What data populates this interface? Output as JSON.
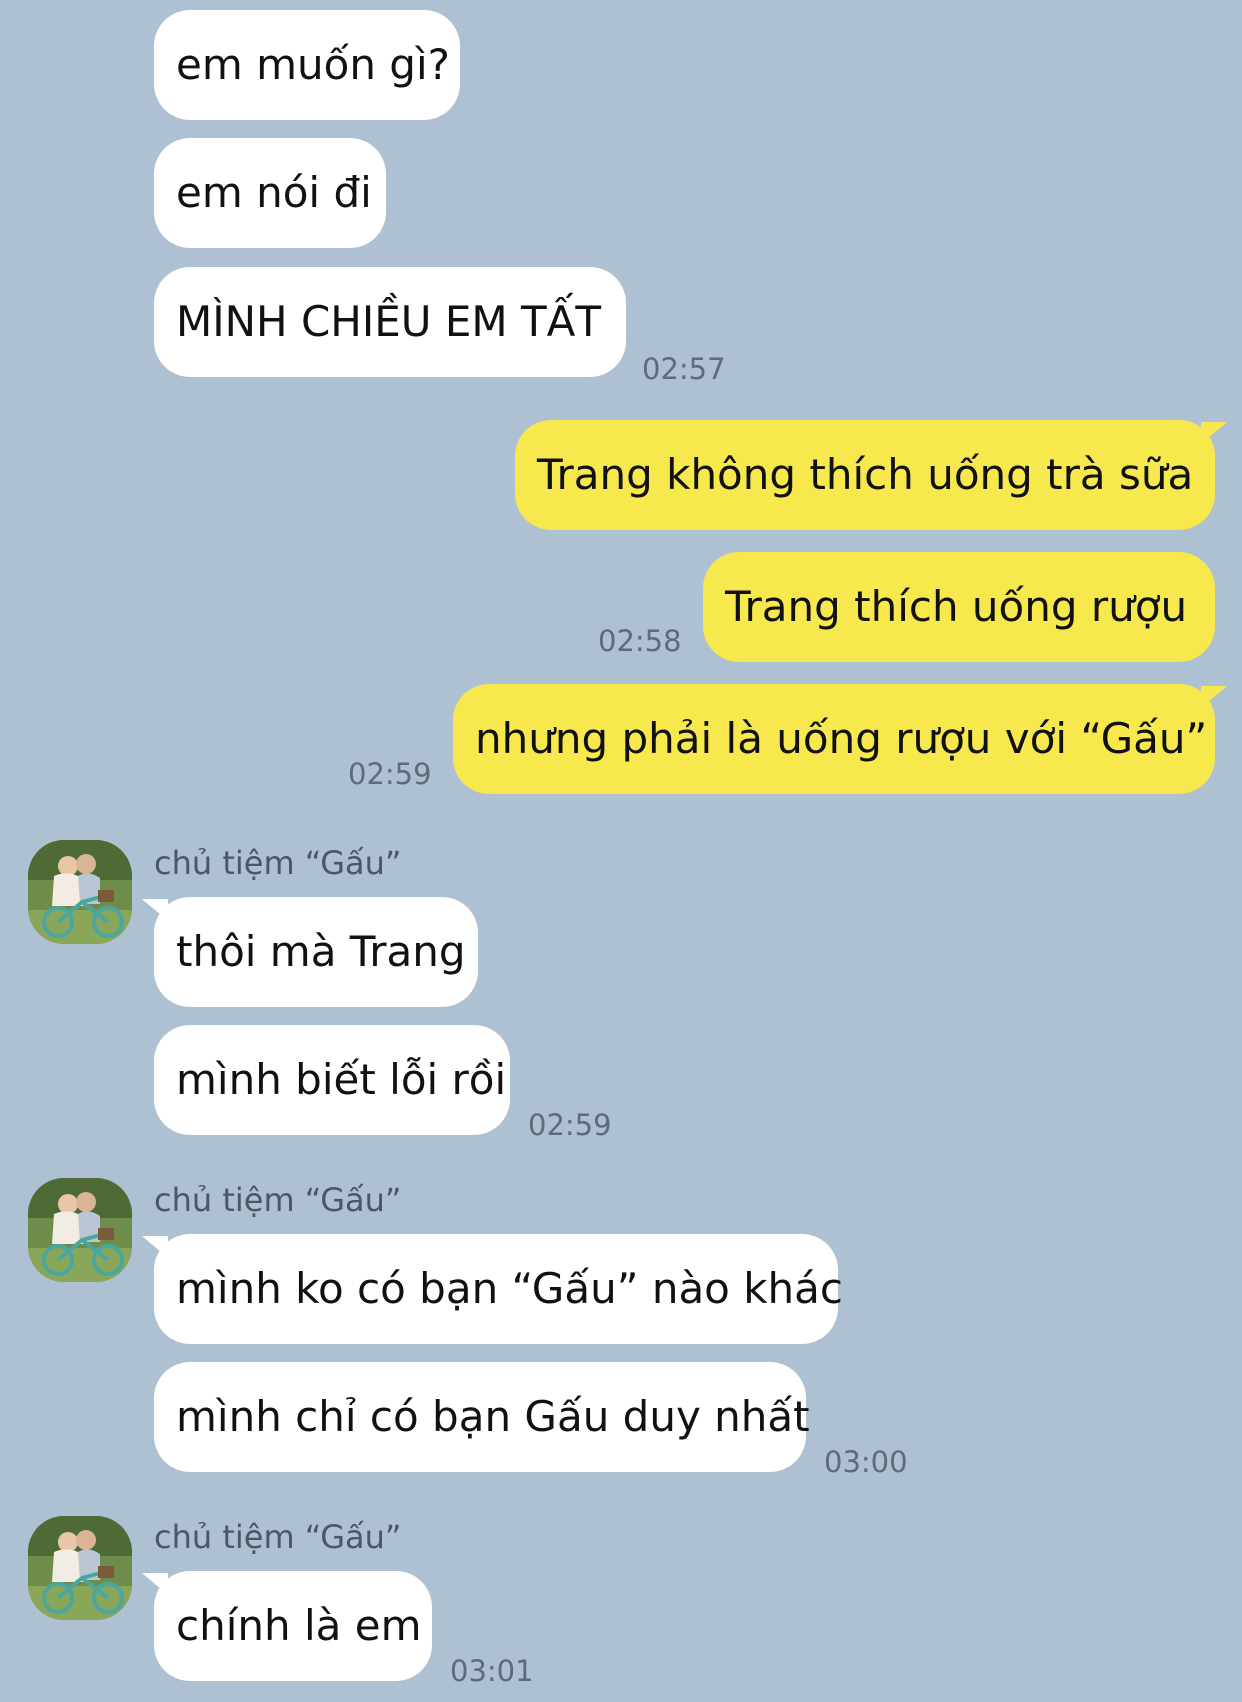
{
  "messages": [
    {
      "text": "em muốn gì?"
    },
    {
      "text": "em nói đi"
    },
    {
      "text": "MÌNH CHIỀU EM TẤT",
      "time": "02:57"
    },
    {
      "text": "Trang không thích uống trà sữa"
    },
    {
      "text": "Trang thích uống rượu",
      "time": "02:58"
    },
    {
      "text": "nhưng phải là uống rượu với “Gấu”",
      "time": "02:59"
    },
    {
      "sender": "chủ tiệm “Gấu”",
      "text": "thôi mà Trang"
    },
    {
      "text": "mình biết lỗi rồi",
      "time": "02:59"
    },
    {
      "sender": "chủ tiệm “Gấu”",
      "text": "mình ko có bạn “Gấu” nào khác"
    },
    {
      "text": "mình chỉ có bạn Gấu duy nhất",
      "time": "03:00"
    },
    {
      "sender": "chủ tiệm “Gấu”",
      "text": "chính là em",
      "time": "03:01"
    }
  ],
  "colors": {
    "background": "#aec1d3",
    "incoming_bubble": "#ffffff",
    "outgoing_bubble": "#f7e84e"
  },
  "icons": {
    "avatar": "contact-photo-avatar"
  }
}
